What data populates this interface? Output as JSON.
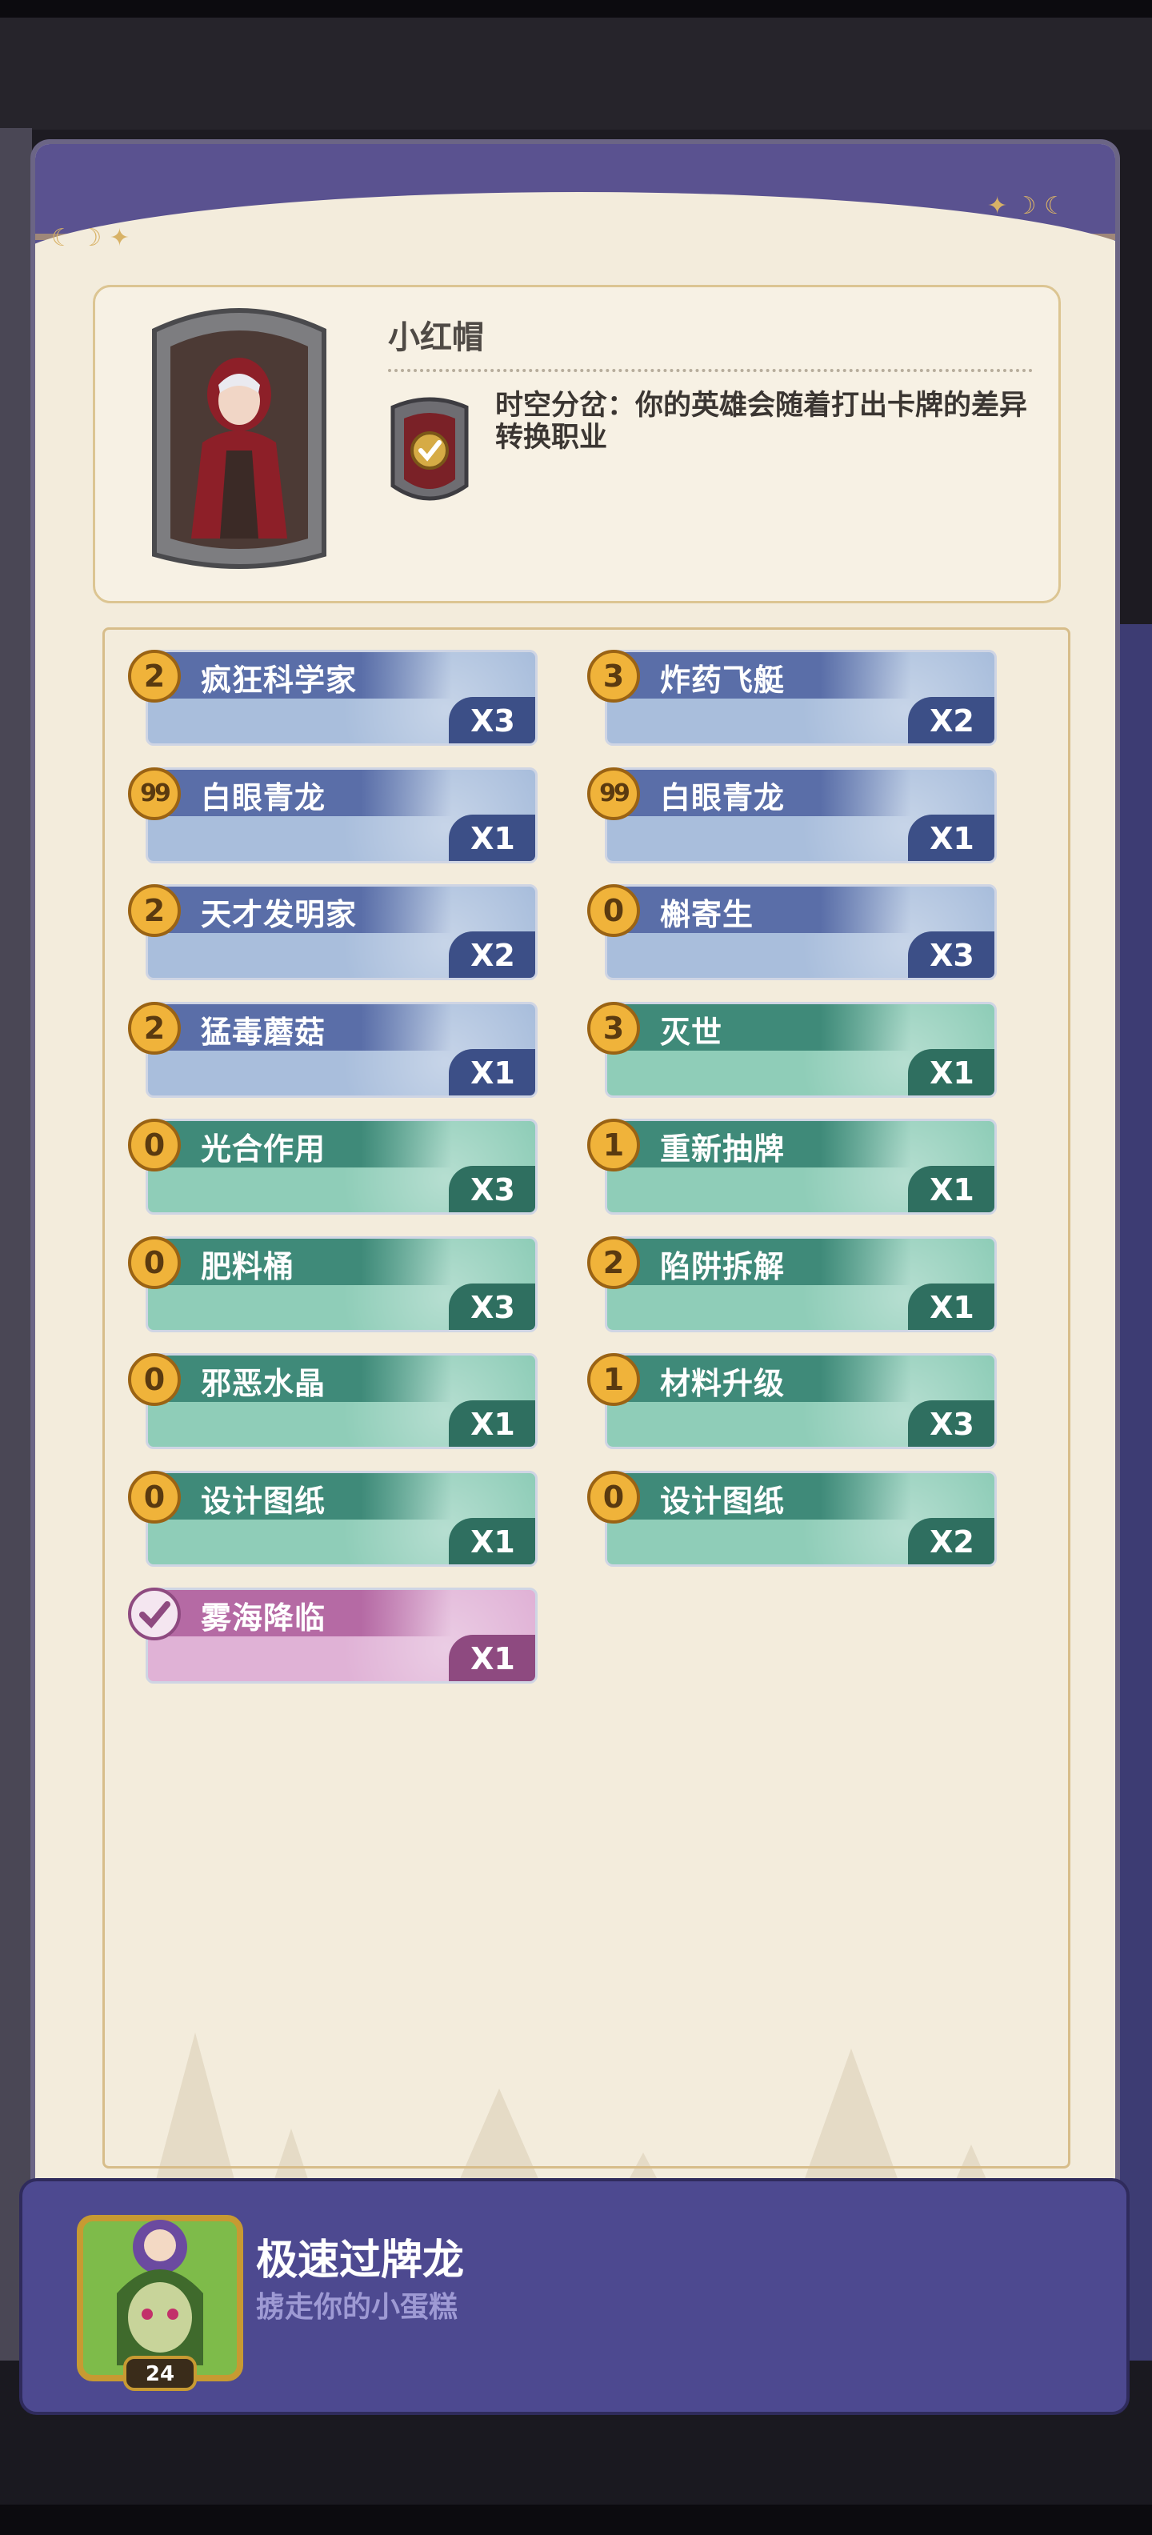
{
  "hero": {
    "name": "小红帽",
    "talent": "时空分岔：你的英雄会随着打出卡牌的差异转换职业"
  },
  "cards": [
    {
      "cost": "2",
      "name": "疯狂科学家",
      "count": "X3",
      "theme": "blue"
    },
    {
      "cost": "3",
      "name": "炸药飞艇",
      "count": "X2",
      "theme": "blue"
    },
    {
      "cost": "99",
      "name": "白眼青龙",
      "count": "X1",
      "theme": "blue"
    },
    {
      "cost": "99",
      "name": "白眼青龙",
      "count": "X1",
      "theme": "blue"
    },
    {
      "cost": "2",
      "name": "天才发明家",
      "count": "X2",
      "theme": "blue"
    },
    {
      "cost": "0",
      "name": "槲寄生",
      "count": "X3",
      "theme": "blue"
    },
    {
      "cost": "2",
      "name": "猛毒蘑菇",
      "count": "X1",
      "theme": "blue"
    },
    {
      "cost": "3",
      "name": "灭世",
      "count": "X1",
      "theme": "teal"
    },
    {
      "cost": "0",
      "name": "光合作用",
      "count": "X3",
      "theme": "teal"
    },
    {
      "cost": "1",
      "name": "重新抽牌",
      "count": "X1",
      "theme": "teal"
    },
    {
      "cost": "0",
      "name": "肥料桶",
      "count": "X3",
      "theme": "teal"
    },
    {
      "cost": "2",
      "name": "陷阱拆解",
      "count": "X1",
      "theme": "teal"
    },
    {
      "cost": "0",
      "name": "邪恶水晶",
      "count": "X1",
      "theme": "teal"
    },
    {
      "cost": "1",
      "name": "材料升级",
      "count": "X3",
      "theme": "teal"
    },
    {
      "cost": "0",
      "name": "设计图纸",
      "count": "X1",
      "theme": "teal"
    },
    {
      "cost": "0",
      "name": "设计图纸",
      "count": "X2",
      "theme": "teal"
    },
    {
      "cost": "",
      "name": "雾海降临",
      "count": "X1",
      "theme": "pink"
    }
  ],
  "deck": {
    "name": "极速过牌龙",
    "subtitle": "掳走你的小蛋糕",
    "level": "24"
  },
  "colors": {
    "blue_bar": "#5a6ea8",
    "blue_body": "#a9bedc",
    "teal_bar": "#3f8a79",
    "teal_body": "#8fcdb8",
    "pink_bar": "#b56aa4",
    "pink_body": "#e0b2d6",
    "footer": "#4d4990"
  }
}
